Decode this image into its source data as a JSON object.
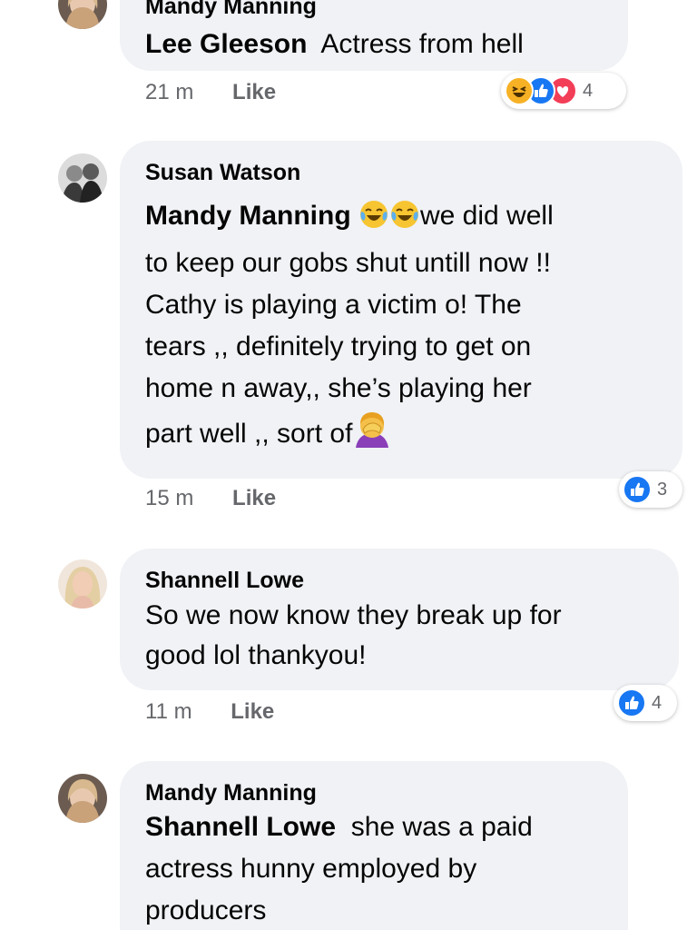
{
  "comments": [
    {
      "author": "Mandy Manning",
      "mention": "Lee Gleeson",
      "text": "Actress from hell",
      "time": "21 m",
      "like": "Like",
      "reaction_count": "4"
    },
    {
      "author": "Susan Watson",
      "mention": "Mandy Manning",
      "text_lines": [
        "we did well",
        "to keep our gobs shut untill now !!",
        "Cathy is playing a victim o! The",
        "tears ,, definitely trying to get on",
        "home n away,, she’s playing her",
        "part well ,, sort of"
      ],
      "time": "15 m",
      "like": "Like",
      "reaction_count": "3"
    },
    {
      "author": "Shannell Lowe",
      "text_lines": [
        "So we now know they break up for",
        "good lol thankyou!"
      ],
      "time": "11 m",
      "like": "Like",
      "reaction_count": "4"
    },
    {
      "author": "Mandy Manning",
      "mention": "Shannell Lowe",
      "text_lines": [
        "she was a paid",
        "actress hunny employed by",
        "producers"
      ]
    }
  ],
  "icons": {
    "like": "like-reaction-icon",
    "love": "love-reaction-icon",
    "haha": "haha-reaction-icon",
    "tears_of_joy": "tears-of-joy-emoji",
    "facepalm": "woman-facepalming-emoji"
  },
  "colors": {
    "bubble": "#f0f2f5",
    "like_blue": "#1877f2",
    "love_red": "#f33e58",
    "haha_yellow": "#f7b125",
    "meta_gray": "#65676b"
  }
}
